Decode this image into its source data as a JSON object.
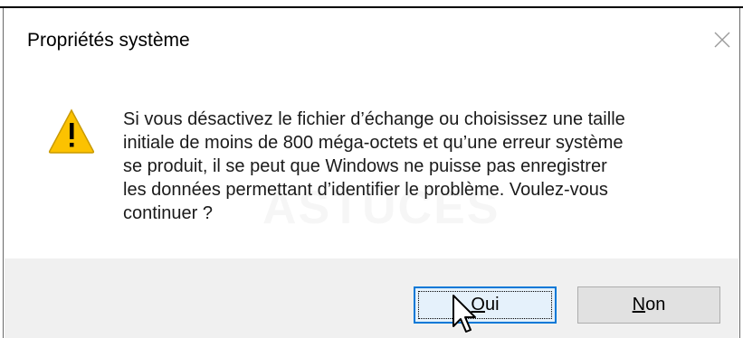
{
  "dialog": {
    "title": "Propriétés système",
    "close_icon": "close-icon",
    "warning_icon": "warning-icon",
    "message": "Si vous désactivez le fichier d’échange ou choisissez une taille\ninitiale de moins de 800 méga-octets et qu’une erreur système\nse produit, il se peut que Windows ne puisse pas enregistrer\nles données permettant d’identifier le problème. Voulez-vous\ncontinuer ?",
    "watermark": "ASTUCES"
  },
  "buttons": {
    "yes_label_underlined": "O",
    "yes_label_rest": "ui",
    "no_label_underlined": "N",
    "no_label_rest": "on"
  },
  "colors": {
    "accent": "#0078d7",
    "warning_yellow": "#fcc200",
    "footer_bg": "#f0f0f0"
  }
}
